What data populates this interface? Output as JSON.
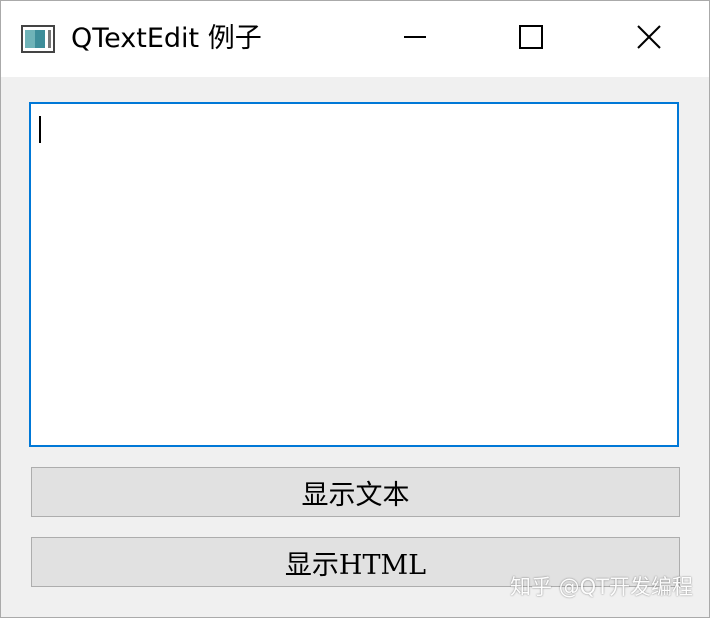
{
  "window": {
    "title": "QTextEdit 例子",
    "controls": {
      "minimize": "minimize-icon",
      "maximize": "maximize-icon",
      "close": "close-icon"
    }
  },
  "editor": {
    "value": ""
  },
  "buttons": {
    "show_text": "显示文本",
    "show_html": "显示HTML"
  },
  "watermark": "知乎 @QT开发编程",
  "colors": {
    "focus_border": "#0078d7",
    "button_bg": "#e1e1e1",
    "window_bg": "#f0f0f0"
  }
}
